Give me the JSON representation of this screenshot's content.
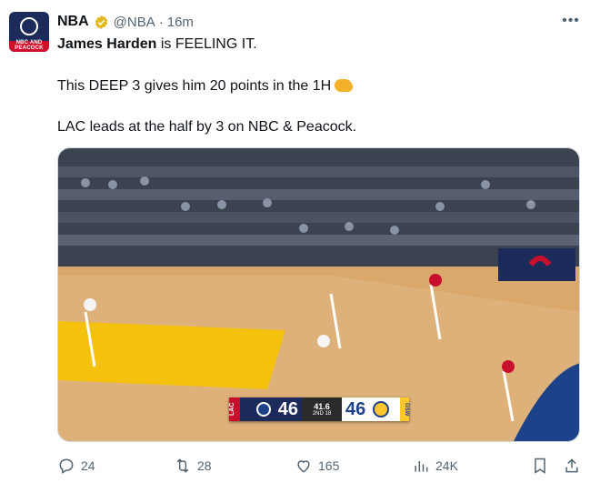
{
  "account": {
    "name": "NBA",
    "handle": "@NBA",
    "separator": "·",
    "time": "16m",
    "avatar_text": "NBC AND PEACOCK"
  },
  "tweet": {
    "line1_bold": "James Harden",
    "line1_rest": " is FEELING IT.",
    "line2": "This DEEP 3 gives him 20 points in the 1H",
    "line3": "LAC leads at the half by 3 on NBC & Peacock."
  },
  "scorebug": {
    "left_team_tag": "LAC",
    "left_score": "46",
    "clock": "41.6",
    "period": "2ND 18",
    "right_score": "46",
    "right_team_tag": "GSW"
  },
  "actions": {
    "replies": "24",
    "reposts": "28",
    "likes": "165",
    "views": "24K"
  },
  "colors": {
    "text_primary": "#0f1419",
    "text_secondary": "#536471",
    "verified": "#e2b719",
    "court": "#d9a86a",
    "paint": "#f4c20d"
  }
}
